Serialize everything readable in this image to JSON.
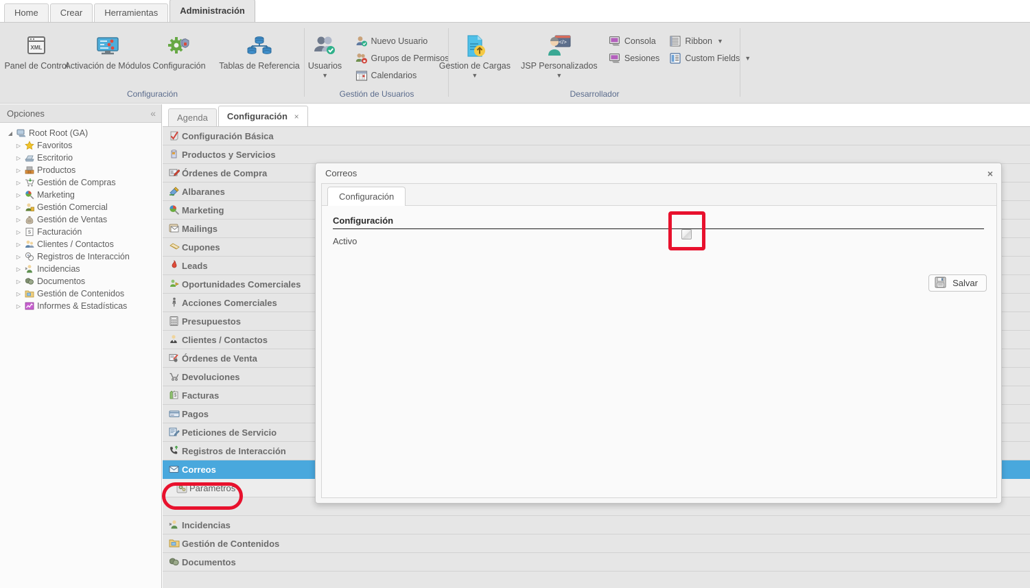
{
  "ribbon": {
    "tabs": [
      {
        "label": "Home",
        "active": false
      },
      {
        "label": "Crear",
        "active": false
      },
      {
        "label": "Herramientas",
        "active": false
      },
      {
        "label": "Administración",
        "active": true
      }
    ],
    "groups": [
      {
        "title": "Configuración",
        "big_buttons": [
          {
            "label": "Panel de Control",
            "icon": "xml-window-icon",
            "caret": false
          },
          {
            "label": "Activación de Módulos",
            "icon": "monitor-sliders-icon",
            "caret": false
          },
          {
            "label": "Configuración",
            "icon": "gear-shield-icon",
            "caret": false
          },
          {
            "label": "Tablas de Referencia",
            "icon": "database-tree-icon",
            "caret": false
          }
        ],
        "small_buttons": []
      },
      {
        "title": "Gestión de Usuarios",
        "big_buttons": [
          {
            "label": "Usuarios",
            "icon": "users-check-icon",
            "caret": true
          }
        ],
        "small_buttons": [
          {
            "label": "Nuevo Usuario",
            "icon": "user-add-icon",
            "caret": false
          },
          {
            "label": "Grupos de Permisos",
            "icon": "user-group-lock-icon",
            "caret": false
          },
          {
            "label": "Calendarios",
            "icon": "calendar-icon",
            "caret": false
          }
        ]
      },
      {
        "title": "Desarrollador",
        "big_buttons": [
          {
            "label": "Gestion de Cargas",
            "icon": "file-upload-icon",
            "caret": true
          },
          {
            "label": "JSP Personalizados",
            "icon": "developer-code-icon",
            "caret": true
          }
        ],
        "small_buttons": [
          {
            "label": "Consola",
            "icon": "console-monitor-icon",
            "caret": false
          },
          {
            "label": "Ribbon",
            "icon": "ribbon-list-icon",
            "caret": true
          },
          {
            "label": "Sesiones",
            "icon": "sessions-monitor-icon",
            "caret": false
          },
          {
            "label": "Custom Fields",
            "icon": "custom-fields-icon",
            "caret": true
          }
        ]
      }
    ]
  },
  "sidebar": {
    "title": "Opciones",
    "collapse_icon": "chevron-double-left-icon",
    "root": {
      "label": "Root Root (GA)",
      "icon": "computer-icon",
      "expanded": true
    },
    "items": [
      {
        "label": "Favoritos",
        "icon": "star-icon"
      },
      {
        "label": "Escritorio",
        "icon": "desktop-icon"
      },
      {
        "label": "Productos",
        "icon": "products-icon"
      },
      {
        "label": "Gestión de Compras",
        "icon": "cart-down-icon"
      },
      {
        "label": "Marketing",
        "icon": "marketing-icon"
      },
      {
        "label": "Gestión Comercial",
        "icon": "business-person-icon"
      },
      {
        "label": "Gestión de Ventas",
        "icon": "money-bag-icon"
      },
      {
        "label": "Facturación",
        "icon": "invoice-icon"
      },
      {
        "label": "Clientes / Contactos",
        "icon": "contacts-icon"
      },
      {
        "label": "Registros de Interacción",
        "icon": "interaction-icon"
      },
      {
        "label": "Incidencias",
        "icon": "incident-icon"
      },
      {
        "label": "Documentos",
        "icon": "documents-icon"
      },
      {
        "label": "Gestión de Contenidos",
        "icon": "content-folder-icon"
      },
      {
        "label": "Informes & Estadísticas",
        "icon": "chart-icon"
      }
    ]
  },
  "main": {
    "tabs": [
      {
        "label": "Agenda",
        "active": false,
        "closable": false
      },
      {
        "label": "Configuración",
        "active": true,
        "closable": true,
        "close_glyph": "×"
      }
    ],
    "config_rows": [
      {
        "label": "Configuración Básica",
        "icon": "check-shield-icon",
        "selected": false,
        "sub": false
      },
      {
        "label": "Productos y Servicios",
        "icon": "box-icon",
        "selected": false,
        "sub": false
      },
      {
        "label": "Órdenes de Compra",
        "icon": "purchase-order-icon",
        "selected": false,
        "sub": false
      },
      {
        "label": "Albaranes",
        "icon": "delivery-note-icon",
        "selected": false,
        "sub": false
      },
      {
        "label": "Marketing",
        "icon": "marketing-icon",
        "selected": false,
        "sub": false
      },
      {
        "label": "Mailings",
        "icon": "mail-icon",
        "selected": false,
        "sub": false
      },
      {
        "label": "Cupones",
        "icon": "coupon-icon",
        "selected": false,
        "sub": false
      },
      {
        "label": "Leads",
        "icon": "flame-icon",
        "selected": false,
        "sub": false
      },
      {
        "label": "Oportunidades Comerciales",
        "icon": "opportunity-icon",
        "selected": false,
        "sub": false
      },
      {
        "label": "Acciones Comerciales",
        "icon": "person-walking-icon",
        "selected": false,
        "sub": false
      },
      {
        "label": "Presupuestos",
        "icon": "calculator-icon",
        "selected": false,
        "sub": false
      },
      {
        "label": "Clientes / Contactos",
        "icon": "contacts-icon",
        "selected": false,
        "sub": false
      },
      {
        "label": "Órdenes de Venta",
        "icon": "sales-order-icon",
        "selected": false,
        "sub": false
      },
      {
        "label": "Devoluciones",
        "icon": "return-cart-icon",
        "selected": false,
        "sub": false
      },
      {
        "label": "Facturas",
        "icon": "invoice-icon",
        "selected": false,
        "sub": false
      },
      {
        "label": "Pagos",
        "icon": "payment-card-icon",
        "selected": false,
        "sub": false
      },
      {
        "label": "Peticiones de Servicio",
        "icon": "service-request-icon",
        "selected": false,
        "sub": false
      },
      {
        "label": "Registros de Interacción",
        "icon": "phone-up-icon",
        "selected": false,
        "sub": false
      },
      {
        "label": "Correos",
        "icon": "envelope-icon",
        "selected": true,
        "sub": false
      },
      {
        "label": "Parámetros",
        "icon": "gears-icon",
        "selected": false,
        "sub": true
      },
      {
        "label": "Incidencias",
        "icon": "incident-icon",
        "selected": false,
        "sub": false
      },
      {
        "label": "Gestión de Contenidos",
        "icon": "content-folder-icon",
        "selected": false,
        "sub": false
      },
      {
        "label": "Documentos",
        "icon": "documents-icon",
        "selected": false,
        "sub": false
      }
    ]
  },
  "modal": {
    "title": "Correos",
    "close_glyph": "×",
    "close_icon": "close-icon",
    "tabs": [
      {
        "label": "Configuración",
        "active": true
      }
    ],
    "section_title": "Configuración",
    "fields": [
      {
        "label": "Activo",
        "type": "checkbox",
        "checked": false
      }
    ],
    "save_button": {
      "label": "Salvar",
      "icon": "floppy-save-icon"
    }
  },
  "annotations": {
    "checkbox_highlight": {
      "color": "#e8112d",
      "target": "activo-checkbox"
    },
    "parametros_highlight": {
      "color": "#e8112d",
      "target": "config-row-parametros"
    }
  }
}
